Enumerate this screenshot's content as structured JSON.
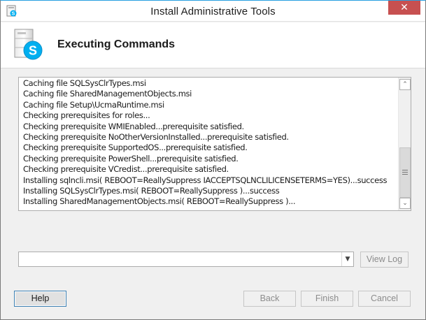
{
  "window": {
    "title": "Install Administrative Tools",
    "close_glyph": "✕",
    "title_icon": "skype-setup-icon"
  },
  "header": {
    "title": "Executing Commands",
    "icon": "skype-server-icon"
  },
  "log": {
    "lines": [
      "Caching file SQLSysClrTypes.msi",
      "Caching file SharedManagementObjects.msi",
      "Caching file Setup\\UcmaRuntime.msi",
      "Checking prerequisites for roles...",
      "Checking prerequisite WMIEnabled...prerequisite satisfied.",
      "Checking prerequisite NoOtherVersionInstalled...prerequisite satisfied.",
      "Checking prerequisite SupportedOS...prerequisite satisfied.",
      "Checking prerequisite PowerShell...prerequisite satisfied.",
      "Checking prerequisite VCredist...prerequisite satisfied.",
      "Installing sqlncli.msi( REBOOT=ReallySuppress IACCEPTSQLNCLILICENSETERMS=YES)...success",
      "Installing SQLSysClrTypes.msi( REBOOT=ReallySuppress )...success",
      "Installing SharedManagementObjects.msi( REBOOT=ReallySuppress )..."
    ],
    "scroll_up_glyph": "⌃",
    "scroll_down_glyph": "⌄"
  },
  "log_combo": {
    "value": "",
    "arrow_glyph": "▼"
  },
  "buttons": {
    "view_log": "View Log",
    "help": "Help",
    "back": "Back",
    "finish": "Finish",
    "cancel": "Cancel"
  },
  "colors": {
    "accent": "#28a0e0",
    "skype_blue": "#00aff0",
    "close_red": "#c75050"
  }
}
